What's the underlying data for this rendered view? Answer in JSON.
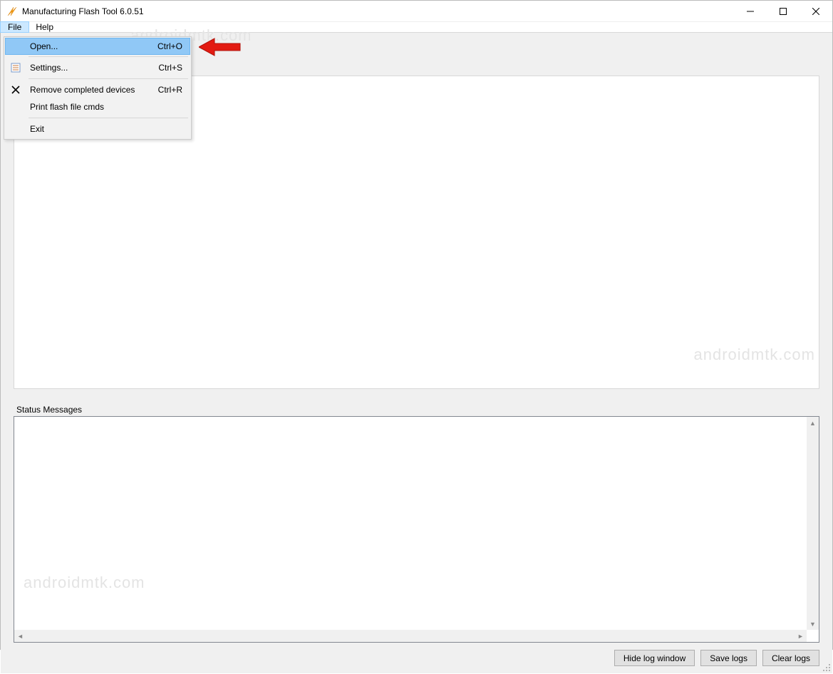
{
  "window": {
    "title": "Manufacturing Flash Tool 6.0.51"
  },
  "menubar": {
    "file": "File",
    "help": "Help"
  },
  "file_menu": {
    "open": {
      "label": "Open...",
      "shortcut": "Ctrl+O"
    },
    "settings": {
      "label": "Settings...",
      "shortcut": "Ctrl+S"
    },
    "remove": {
      "label": "Remove completed devices",
      "shortcut": "Ctrl+R"
    },
    "print": {
      "label": "Print flash file cmds",
      "shortcut": ""
    },
    "exit": {
      "label": "Exit",
      "shortcut": ""
    }
  },
  "status": {
    "label": "Status Messages"
  },
  "buttons": {
    "hide_log": "Hide log window",
    "save_logs": "Save logs",
    "clear_logs": "Clear logs"
  },
  "watermark": "androidmtk.com"
}
